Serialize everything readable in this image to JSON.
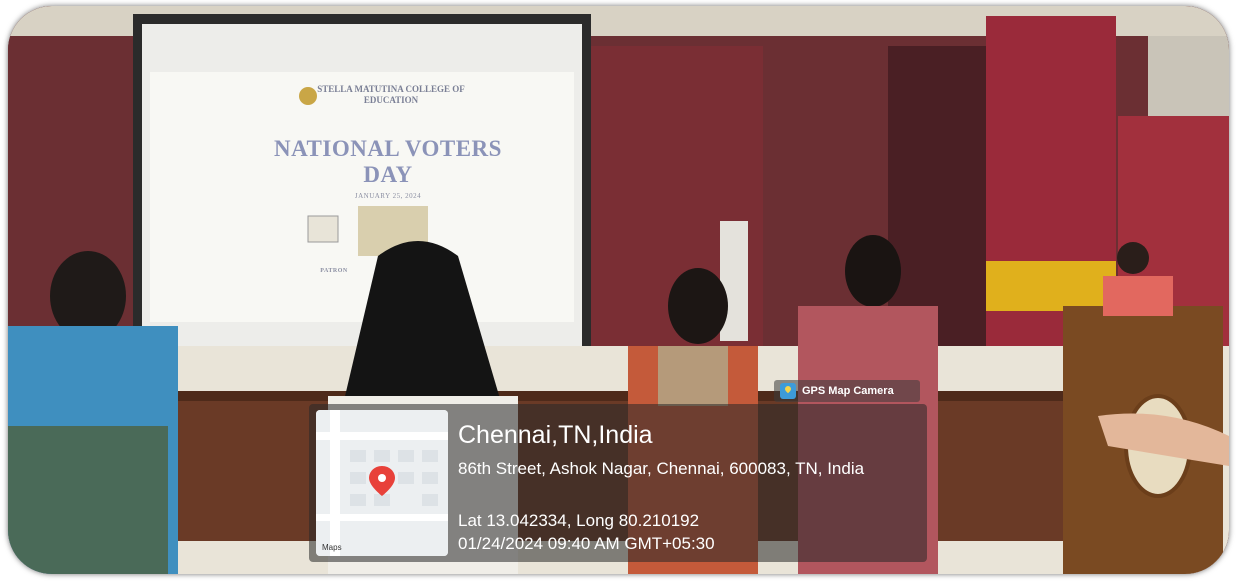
{
  "slide": {
    "college": "STELLA MATUTINA COLLEGE OF EDUCATION",
    "title": "NATIONAL VOTERS DAY",
    "date": "JANUARY 25, 2024",
    "patron": "PATRON"
  },
  "gps": {
    "badge": "GPS Map Camera",
    "map_label": "Maps",
    "city": "Chennai,TN,India",
    "address": "86th Street, Ashok Nagar, Chennai, 600083, TN, India",
    "coordinates": "Lat 13.042334, Long 80.210192",
    "timestamp": "01/24/2024 09:40 AM GMT+05:30"
  }
}
